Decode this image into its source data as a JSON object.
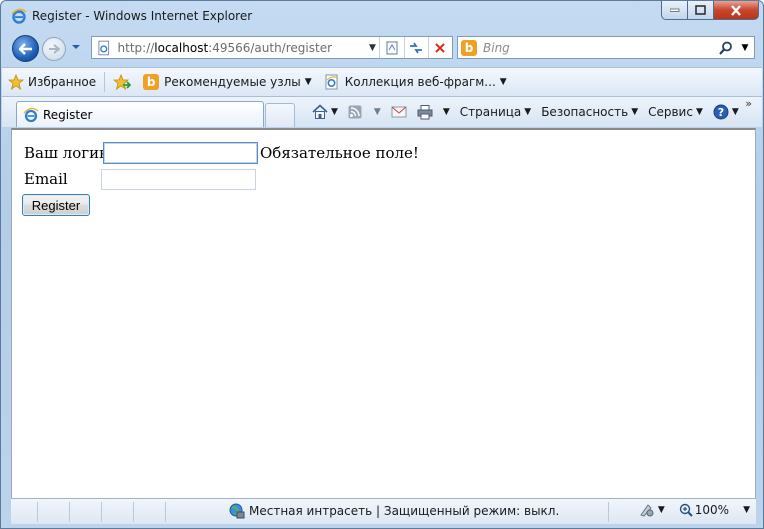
{
  "window": {
    "title": "Register - Windows Internet Explorer"
  },
  "navigation": {
    "address_prefix": "http://",
    "address_host": "localhost",
    "address_rest": ":49566/auth/register",
    "search_placeholder": "Bing"
  },
  "favorites_bar": {
    "favorites_label": "Избранное",
    "suggested_sites_label": "Рекомендуемые узлы",
    "web_slice_gallery_label": "Коллекция веб-фрагм..."
  },
  "tabs": [
    {
      "label": "Register"
    }
  ],
  "command_bar": {
    "page_label": "Страница",
    "safety_label": "Безопасность",
    "tools_label": "Сервис"
  },
  "form": {
    "login_label": "Ваш логин",
    "login_value": "",
    "required_message": "Обязательное поле!",
    "email_label": "Email",
    "email_value": "",
    "submit_label": "Register"
  },
  "status_bar": {
    "zone_text": "Местная интрасеть | Защищенный режим: выкл.",
    "zoom": "100%"
  },
  "colors": {
    "frame": "#bcd3ec",
    "close_button": "#c7462d",
    "back_button": "#1f5fb8",
    "bing": "#f0a022"
  }
}
